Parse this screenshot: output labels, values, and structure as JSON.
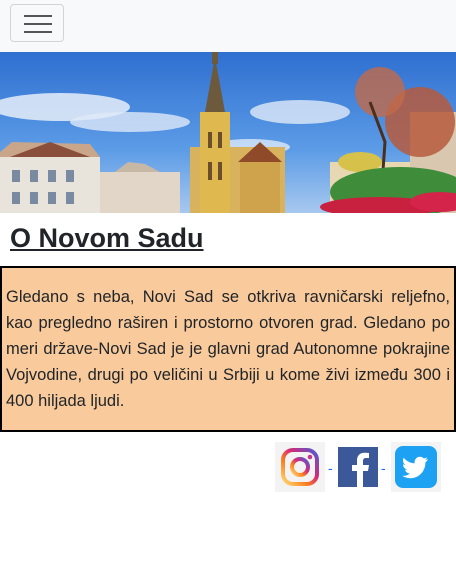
{
  "navbar": {
    "toggle_icon": "hamburger-icon"
  },
  "hero": {
    "image": "novi-sad-cathedral-photo"
  },
  "page": {
    "title": "O Novom Sadu",
    "paragraph": "Gledano s neba, Novi Sad se otkriva ravničarski reljefno, kao pregledno raširen i prostorno otvoren grad. Gledano po meri države-Novi Sad je je glavni grad Autonomne pokrajine Vojvodine, drugi po veličini u Srbiji u kome živi između 300 i 400 hiljada ljudi."
  },
  "social": {
    "separator": "-",
    "links": [
      {
        "name": "instagram-icon"
      },
      {
        "name": "facebook-icon"
      },
      {
        "name": "twitter-icon"
      }
    ]
  },
  "colors": {
    "navbar_bg": "#f8f9fa",
    "textbox_bg": "#f9ca9b",
    "facebook": "#3b5998",
    "twitter": "#1da1f2"
  }
}
